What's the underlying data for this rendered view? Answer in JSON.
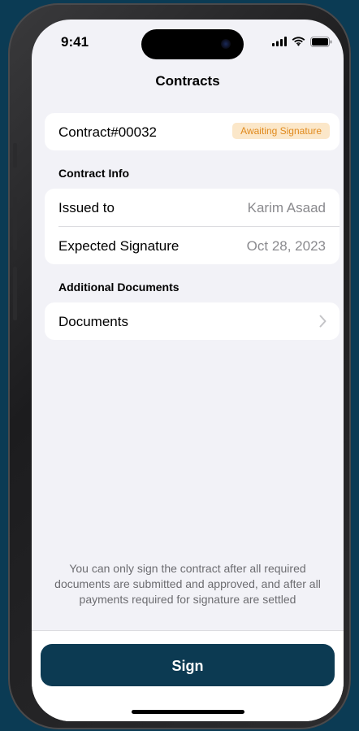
{
  "status_bar": {
    "time": "9:41"
  },
  "nav": {
    "title": "Contracts"
  },
  "contract": {
    "id": "Contract#00032",
    "status_badge": "Awaiting Signature",
    "status_color": "#e08a1e"
  },
  "contract_info": {
    "section_title": "Contract Info",
    "rows": [
      {
        "label": "Issued to",
        "value": "Karim Asaad"
      },
      {
        "label": "Expected Signature",
        "value": "Oct 28, 2023"
      }
    ]
  },
  "additional_documents": {
    "section_title": "Additional Documents",
    "items": [
      {
        "label": "Documents"
      }
    ]
  },
  "footnote": "You can only sign the contract after all required documents are submitted and approved, and after all payments required for signature are settled",
  "actions": {
    "sign_label": "Sign",
    "sign_color": "#0c3a52"
  }
}
